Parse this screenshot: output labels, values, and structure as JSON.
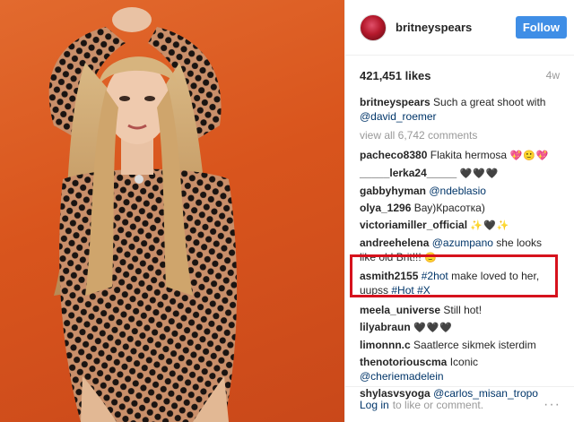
{
  "header": {
    "username": "britneyspears",
    "follow_label": "Follow"
  },
  "stats": {
    "likes": "421,451 likes",
    "age": "4w"
  },
  "caption": {
    "user": "britneyspears",
    "text": "Such a great shoot with",
    "mention": "@david_roemer"
  },
  "view_all": "view all 6,742 comments",
  "comments": [
    {
      "user": "pacheco8380",
      "text": "Flakita hermosa",
      "emoji": "💖🙂💖"
    },
    {
      "user": "_____lerka24_____",
      "text": "",
      "emoji": "🖤🖤🖤"
    },
    {
      "user": "gabbyhyman",
      "text": "",
      "mention": "@ndeblasio"
    },
    {
      "user": "olya_1296",
      "text": "Вау)Красотка)"
    },
    {
      "user": "victoriamiller_official",
      "text": "",
      "emoji": "✨🖤✨"
    },
    {
      "user": "andreehelena",
      "text": "she looks like old Brit!!!",
      "mention": "@azumpano",
      "emoji": "🙂"
    },
    {
      "user": "asmith2155",
      "tag1": "#2hot",
      "text": "make loved to her, uupss",
      "tag2": "#Hot",
      "tag3": "#X"
    },
    {
      "user": "meela_universe",
      "text": "Still hot!"
    },
    {
      "user": "lilyabraun",
      "text": "",
      "emoji": "🖤🖤🖤"
    },
    {
      "user": "limonnn.c",
      "text": "Saatlerce sikmek isterdim"
    },
    {
      "user": "thenotoriouscma",
      "text": "Iconic",
      "mention": "@cheriemadelein"
    },
    {
      "user": "shylasvsyoga",
      "text": "",
      "mention": "@carlos_misan_tropo"
    }
  ],
  "footer": {
    "login_label": "Log in",
    "suffix": "to like or comment.",
    "more_icon": "···"
  },
  "colors": {
    "follow": "#3f8ee6",
    "highlight": "#d6121d",
    "photo_bg": "#d9551d"
  }
}
